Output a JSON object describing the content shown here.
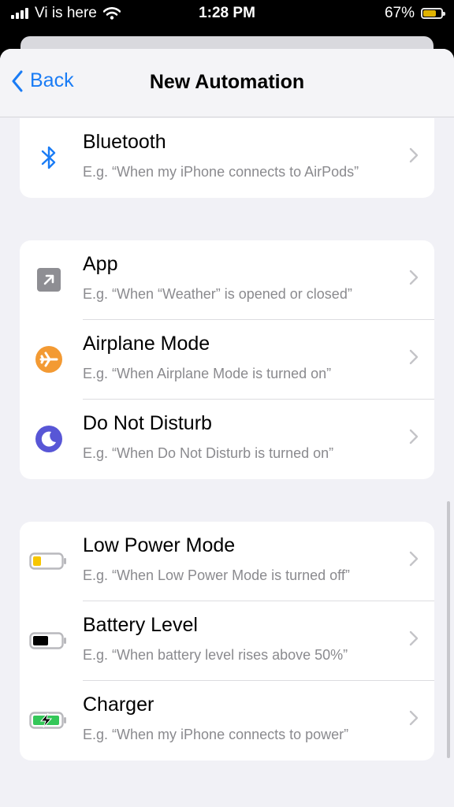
{
  "status": {
    "carrier": "Vi is here",
    "time": "1:28 PM",
    "battery_percent": "67%",
    "battery_level": 0.67
  },
  "nav": {
    "back_label": "Back",
    "title": "New Automation"
  },
  "groups": [
    {
      "items": [
        {
          "title": "Bluetooth",
          "subtitle": "E.g. “When my iPhone connects to AirPods”",
          "icon": "bluetooth-icon"
        }
      ]
    },
    {
      "items": [
        {
          "title": "App",
          "subtitle": "E.g. “When “Weather” is opened or closed”",
          "icon": "app-open-icon"
        },
        {
          "title": "Airplane Mode",
          "subtitle": "E.g. “When Airplane Mode is turned on”",
          "icon": "airplane-icon"
        },
        {
          "title": "Do Not Disturb",
          "subtitle": "E.g. “When Do Not Disturb is turned on”",
          "icon": "moon-icon"
        }
      ]
    },
    {
      "items": [
        {
          "title": "Low Power Mode",
          "subtitle": "E.g. “When Low Power Mode is turned off”",
          "icon": "low-power-battery-icon"
        },
        {
          "title": "Battery Level",
          "subtitle": "E.g. “When battery level rises above 50%”",
          "icon": "battery-level-icon"
        },
        {
          "title": "Charger",
          "subtitle": "E.g. “When my iPhone connects to power”",
          "icon": "charging-battery-icon"
        }
      ]
    }
  ],
  "colors": {
    "accent": "#1a7cf5",
    "airplane": "#f39a33",
    "moon": "#5856d6",
    "low_power": "#f7c600",
    "charging": "#34c759"
  }
}
